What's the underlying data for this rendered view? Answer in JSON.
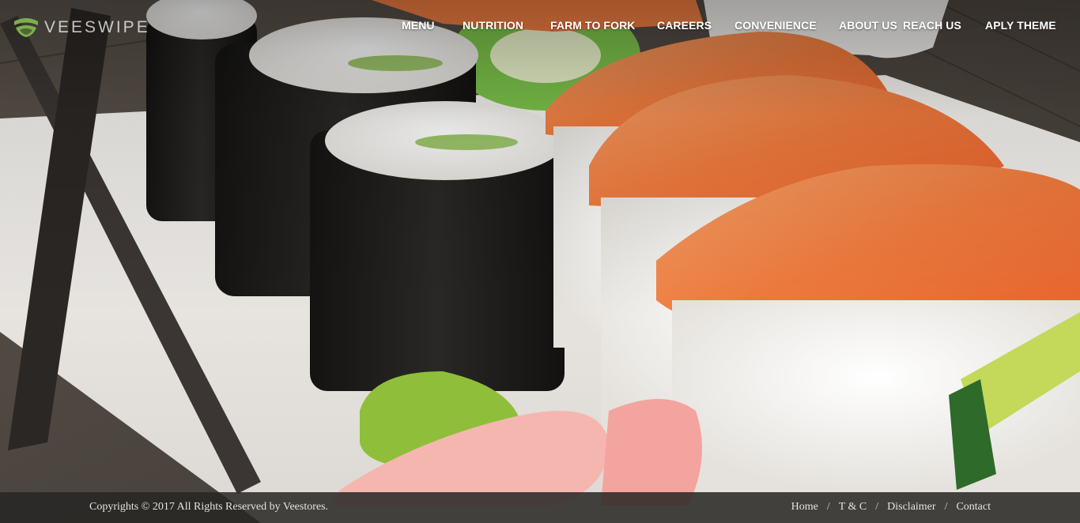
{
  "brand": {
    "name": "VEESWIPE",
    "logo_icon": "leaf-logo-icon",
    "logo_color": "#7bb04a"
  },
  "nav": {
    "items": [
      {
        "label": "MENU"
      },
      {
        "label": "NUTRITION"
      },
      {
        "label": "FARM TO FORK"
      },
      {
        "label": "CAREERS"
      },
      {
        "label": "CONVENIENCE"
      },
      {
        "label": "ABOUT US"
      },
      {
        "label": "REACH US"
      },
      {
        "label": "APLY THEME"
      }
    ]
  },
  "hero": {
    "image_subject": "sushi-platter-background"
  },
  "footer": {
    "copyright": "Copyrights © 2017 All Rights Reserved by Veestores.",
    "links": [
      {
        "label": "Home"
      },
      {
        "label": "T & C"
      },
      {
        "label": "Disclaimer"
      },
      {
        "label": "Contact"
      }
    ],
    "separator": "/"
  },
  "colors": {
    "footer_bg": "#2a2826",
    "nav_text": "#ffffff",
    "salmon": "#f0844a",
    "wasabi": "#8fbf3a",
    "ginger": "#f6b6b0",
    "nori": "#1c1b1a"
  }
}
